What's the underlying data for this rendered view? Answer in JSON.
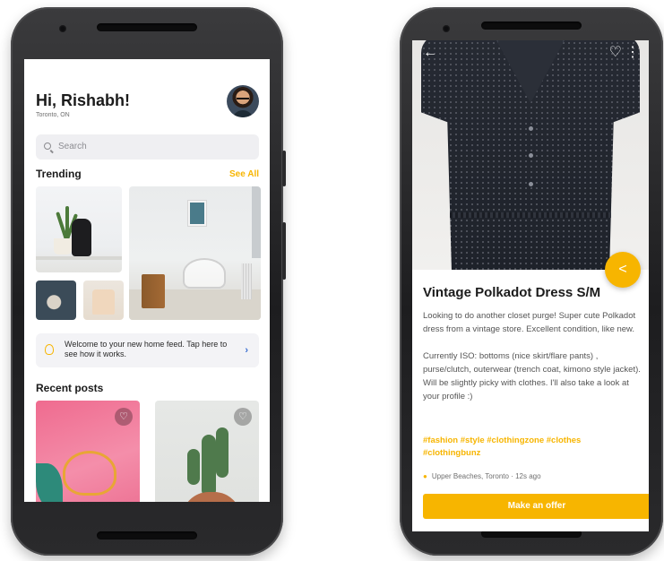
{
  "left_screen": {
    "greeting": "Hi, Rishabh!",
    "location": "Toronto, ON",
    "search_placeholder": "Search",
    "trending_title": "Trending",
    "see_all": "See All",
    "banner_text": "Welcome to your new home feed. Tap here to see how it works.",
    "banner_arrow": "›",
    "recent_title": "Recent posts",
    "heart_glyph": "♡"
  },
  "right_screen": {
    "back_glyph": "←",
    "heart_glyph": "♡",
    "more_glyph": "⋮",
    "share_glyph": "<",
    "title": "Vintage Polkadot Dress S/M",
    "description_1": "Looking to do another closet purge! Super cute Polkadot dress from a vintage store. Excellent condition, like new.",
    "description_2": "Currently ISO: bottoms (nice skirt/flare pants) , purse/clutch, outerwear (trench coat, kimono style jacket). Will be slightly picky with clothes. I'll also take a look at your profile :)",
    "tags": "#fashion #style #clothingzone #clothes #clothingbunz",
    "meta": "Upper Beaches, Toronto · 12s ago",
    "pin_glyph": "●",
    "cta": "Make an offer"
  },
  "colors": {
    "accent": "#f7b500",
    "text_dark": "#1b1b1b",
    "text_muted": "#6f6f6f"
  }
}
